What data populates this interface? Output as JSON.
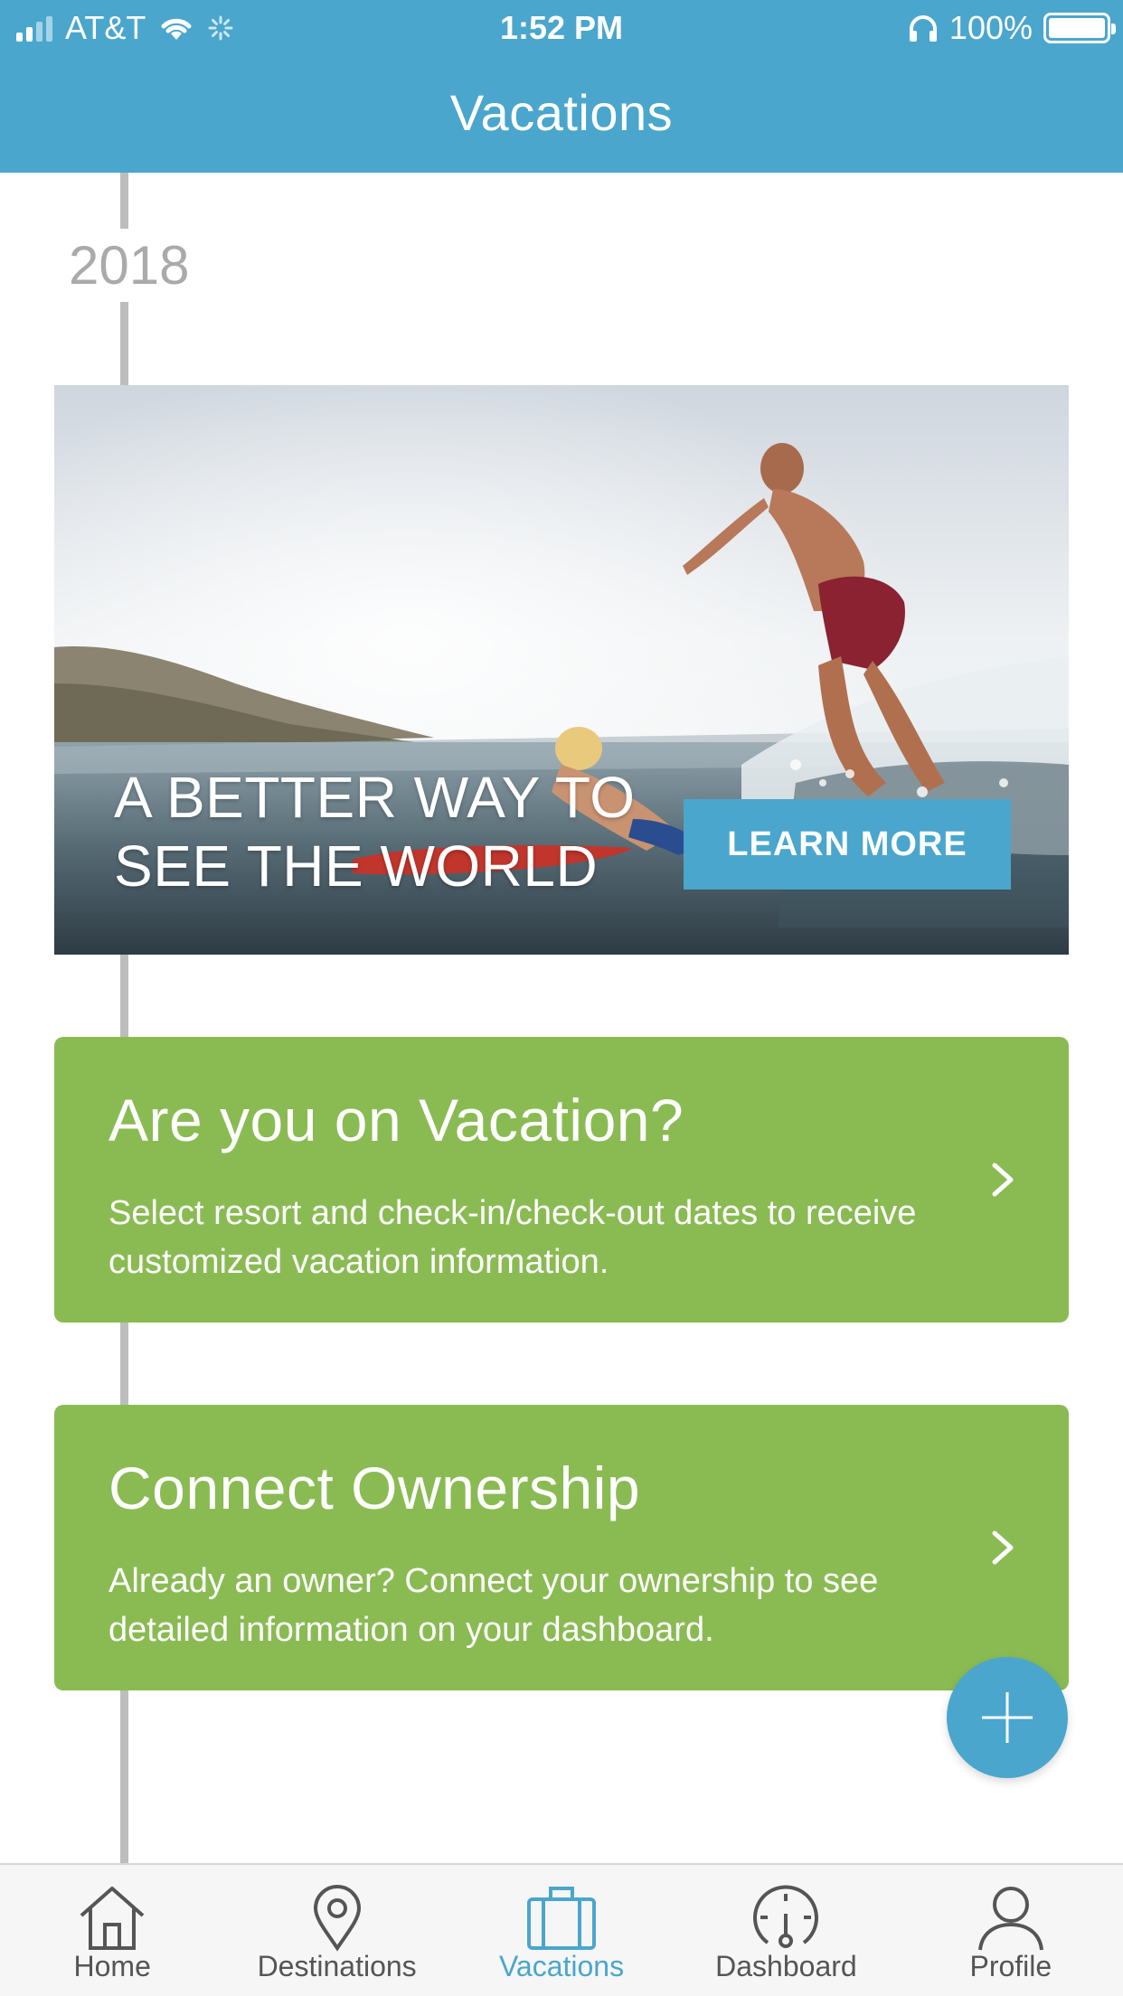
{
  "status_bar": {
    "carrier": "AT&T",
    "time": "1:52 PM",
    "battery": "100%"
  },
  "header": {
    "title": "Vacations"
  },
  "timeline": {
    "year": "2018"
  },
  "promo": {
    "headline_line1": "A BETTER WAY TO",
    "headline_line2": "SEE THE WORLD",
    "cta_label": "LEARN MORE"
  },
  "cards": [
    {
      "title": "Are you on Vacation?",
      "description": "Select resort and check-in/check-out dates to receive customized vacation information."
    },
    {
      "title": "Connect Ownership",
      "description": "Already an owner? Connect your ownership to see detailed information on your dashboard."
    }
  ],
  "tabs": [
    {
      "label": "Home",
      "icon": "home-icon",
      "active": false
    },
    {
      "label": "Destinations",
      "icon": "map-pin-icon",
      "active": false
    },
    {
      "label": "Vacations",
      "icon": "suitcase-icon",
      "active": true
    },
    {
      "label": "Dashboard",
      "icon": "gauge-icon",
      "active": false
    },
    {
      "label": "Profile",
      "icon": "person-icon",
      "active": false
    }
  ],
  "colors": {
    "brand_blue": "#4aa6cc",
    "card_green": "#8abb53",
    "timeline_gray": "#bdbdbd"
  }
}
